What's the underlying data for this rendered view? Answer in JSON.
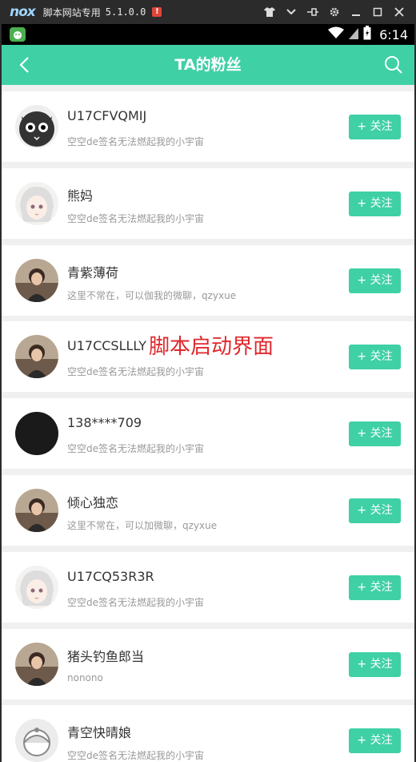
{
  "emulator": {
    "logo": "nox",
    "title": "脚本网站专用",
    "version": "5.1.0.0",
    "alert": "!"
  },
  "status_bar": {
    "time": "6:14"
  },
  "header": {
    "title": "TA的粉丝"
  },
  "fans": [
    {
      "name": "U17CFVQMIJ",
      "signature": "空空de签名无法燃起我的小宇宙",
      "follow_label": "+ 关注",
      "avatar": "cartoon-cat-avatar"
    },
    {
      "name": "熊妈",
      "signature": "空空de签名无法燃起我的小宇宙",
      "follow_label": "+ 关注",
      "avatar": "anime-girl-avatar"
    },
    {
      "name": "青紫薄荷",
      "signature": "这里不常在，可以伽我的微聊，qzyxue",
      "follow_label": "+ 关注",
      "avatar": "photo-avatar"
    },
    {
      "name": "U17CCSLLLY",
      "signature": "空空de签名无法燃起我的小宇宙",
      "follow_label": "+ 关注",
      "avatar": "photo-avatar"
    },
    {
      "name": "138****709",
      "signature": "空空de签名无法燃起我的小宇宙",
      "follow_label": "+ 关注",
      "avatar": "black-avatar"
    },
    {
      "name": "倾心独恋",
      "signature": "这里不常在，可以加微聊，qzyxue",
      "follow_label": "+ 关注",
      "avatar": "photo-avatar"
    },
    {
      "name": "U17CQ53R3R",
      "signature": "空空de签名无法燃起我的小宇宙",
      "follow_label": "+ 关注",
      "avatar": "anime-girl-avatar"
    },
    {
      "name": "猪头钓鱼郎当",
      "signature": "nonono",
      "follow_label": "+ 关注",
      "avatar": "photo-avatar"
    },
    {
      "name": "青空快晴娘",
      "signature": "空空de签名无法燃起我的小宇宙",
      "follow_label": "+ 关注",
      "avatar": "cartoon-avatar"
    }
  ],
  "overlay": {
    "text": "脚本启动界面"
  },
  "colors": {
    "accent": "#3fd0a6",
    "overlay_text": "#e0282c"
  }
}
